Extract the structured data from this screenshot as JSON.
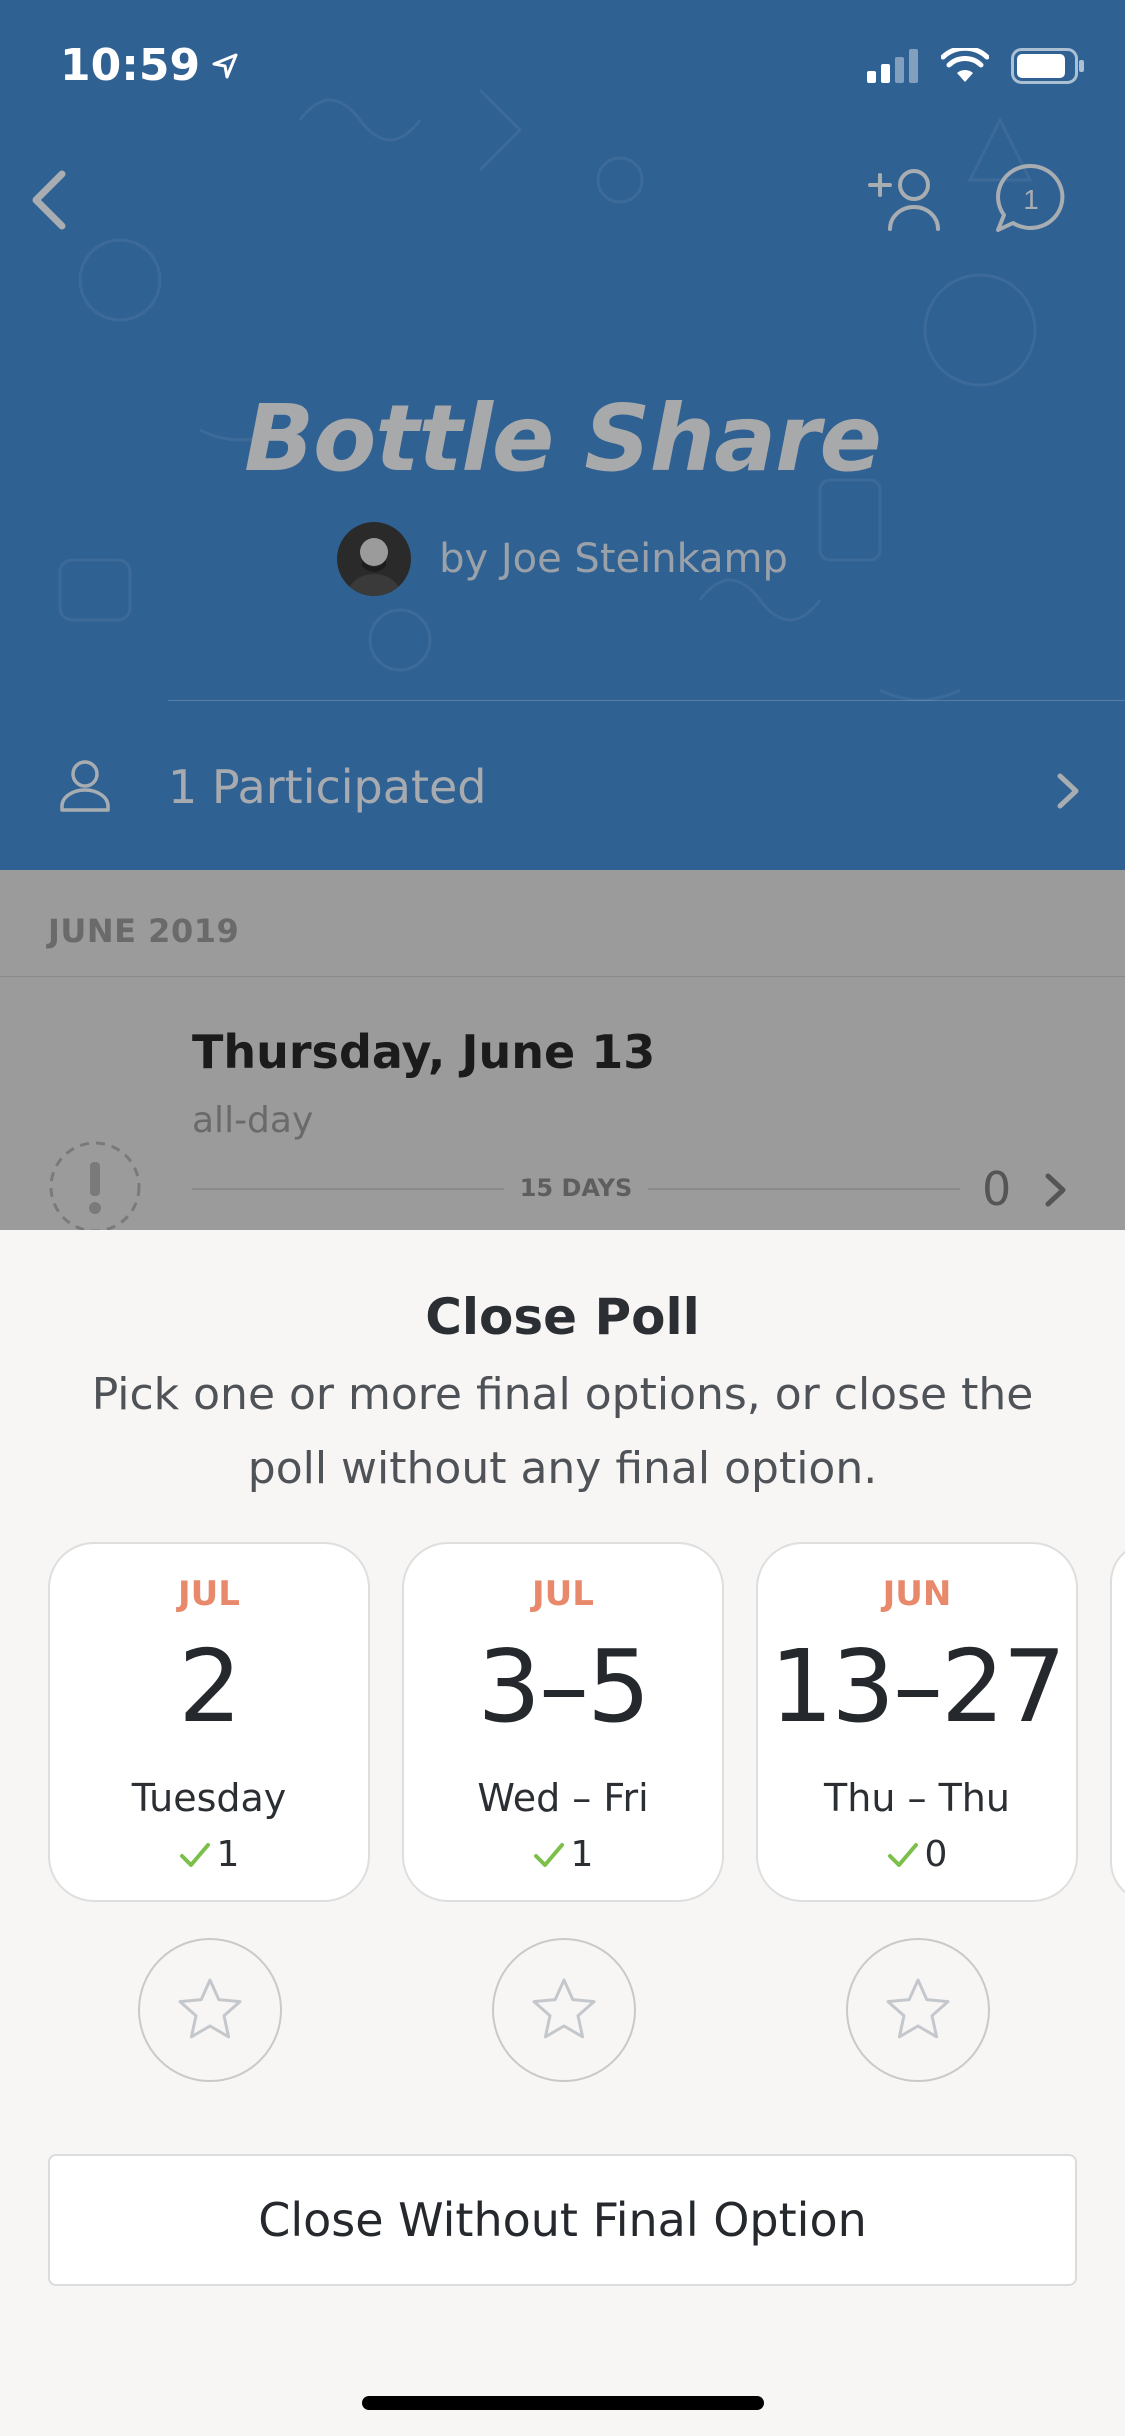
{
  "status_bar": {
    "time": "10:59"
  },
  "header": {
    "title": "Bottle Share",
    "byline": "by Joe Steinkamp",
    "comment_count": "1",
    "participated": "1 Participated"
  },
  "list": {
    "month": "JUNE 2019",
    "event_title": "Thursday, June 13",
    "event_sub": "all-day",
    "days_label": "15 DAYS",
    "count": "0"
  },
  "sheet": {
    "title": "Close Poll",
    "description": "Pick one or more final options, or close the poll without any final option.",
    "options": [
      {
        "month": "JUL",
        "date": "2",
        "weekday": "Tuesday",
        "votes": "1"
      },
      {
        "month": "JUL",
        "date": "3–5",
        "weekday": "Wed – Fri",
        "votes": "1"
      },
      {
        "month": "JUN",
        "date": "13–27",
        "weekday": "Thu – Thu",
        "votes": "0"
      }
    ],
    "close_button": "Close Without Final Option"
  },
  "colors": {
    "header_blue": "#306193",
    "accent_orange": "#e8896b",
    "check_green": "#7cc04b"
  }
}
